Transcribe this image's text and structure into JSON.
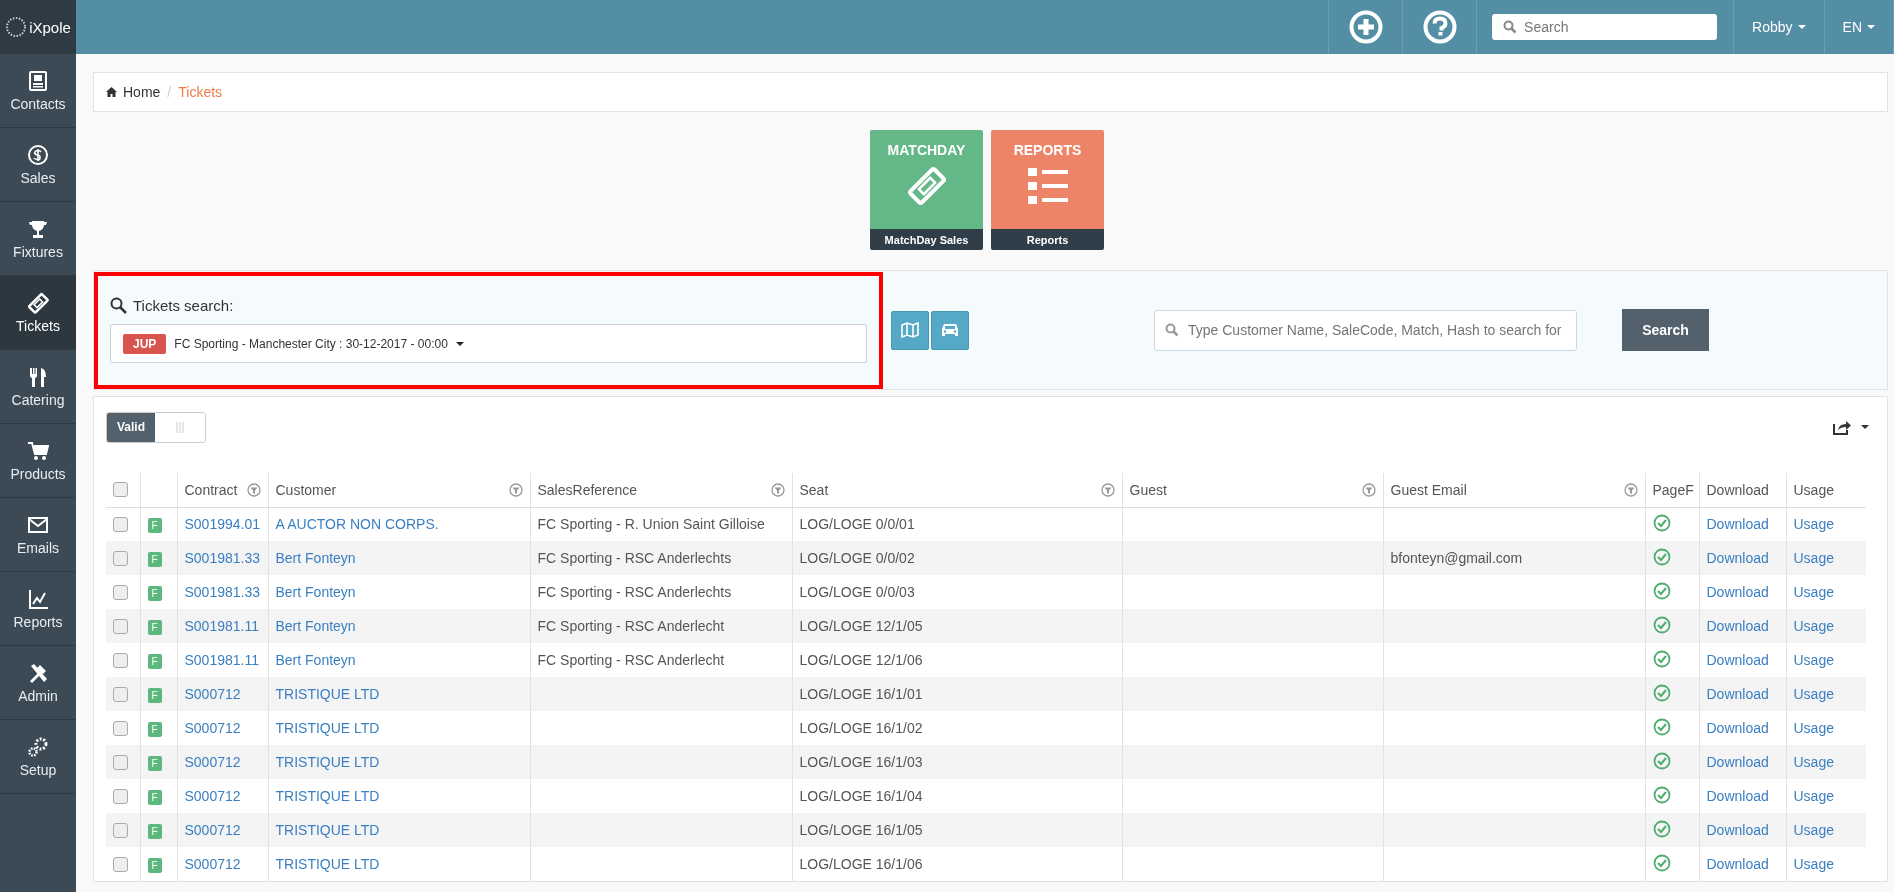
{
  "sidebar": {
    "logo": "iXpole",
    "items": [
      {
        "label": "Contacts",
        "selected": false
      },
      {
        "label": "Sales",
        "selected": false
      },
      {
        "label": "Fixtures",
        "selected": false
      },
      {
        "label": "Tickets",
        "selected": true
      },
      {
        "label": "Catering",
        "selected": false
      },
      {
        "label": "Products",
        "selected": false
      },
      {
        "label": "Emails",
        "selected": false
      },
      {
        "label": "Reports",
        "selected": false
      },
      {
        "label": "Admin",
        "selected": false
      },
      {
        "label": "Setup",
        "selected": false
      }
    ]
  },
  "topbar": {
    "search": {
      "placeholder": "Search"
    },
    "user": "Robby",
    "language": "EN"
  },
  "breadcrumb": [
    {
      "label": "Home",
      "current": false
    },
    {
      "separator": "/",
      "label": "Tickets",
      "current": true
    }
  ],
  "tiles": [
    {
      "title": "MATCHDAY",
      "caption": "MatchDay Sales",
      "color": "#64b888"
    },
    {
      "title": "REPORTS",
      "caption": "Reports",
      "color": "#ee8467"
    }
  ],
  "tickets_search": {
    "label": "Tickets search:",
    "select": {
      "tag": "JUP",
      "value": "FC Sporting - Manchester City : 30-12-2017 - 00:00"
    },
    "highlighted": true
  },
  "quick_search": {
    "placeholder": "Type Customer Name, SaleCode, Match, Hash to search for",
    "button": "Search"
  },
  "valid_toggle": {
    "label": "Valid",
    "on": true
  },
  "table": {
    "select_all": {
      "checked": false
    },
    "columns": [
      {
        "label": "Contract",
        "filter": true
      },
      {
        "label": "Customer",
        "filter": true
      },
      {
        "label": "SalesReference",
        "filter": true
      },
      {
        "label": "Seat",
        "filter": true
      },
      {
        "label": "Guest",
        "filter": true
      },
      {
        "label": "Guest Email",
        "filter": true
      },
      {
        "label": "PageF",
        "filter": false
      },
      {
        "label": "Download",
        "filter": false
      },
      {
        "label": "Usage",
        "filter": false
      }
    ],
    "rows": [
      {
        "checked": false,
        "badge": "F",
        "contract": "S001994.01",
        "customer": "A AUCTOR NON CORPS.",
        "sales_reference": "FC Sporting - R. Union Saint Gilloise",
        "seat": "LOG/LOGE 0/0/01",
        "page_ok": true,
        "download": "Download",
        "usage": "Usage"
      },
      {
        "checked": false,
        "badge": "F",
        "contract": "S001981.33",
        "customer": "Bert Fonteyn",
        "sales_reference": "FC Sporting - RSC Anderlechts",
        "seat": "LOG/LOGE 0/0/02",
        "guest_email": "bfonteyn@gmail.com",
        "page_ok": true,
        "download": "Download",
        "usage": "Usage"
      },
      {
        "checked": false,
        "badge": "F",
        "contract": "S001981.33",
        "customer": "Bert Fonteyn",
        "sales_reference": "FC Sporting - RSC Anderlechts",
        "seat": "LOG/LOGE 0/0/03",
        "page_ok": true,
        "download": "Download",
        "usage": "Usage"
      },
      {
        "checked": false,
        "badge": "F",
        "contract": "S001981.11",
        "customer": "Bert Fonteyn",
        "sales_reference": "FC Sporting - RSC Anderlecht",
        "seat": "LOG/LOGE 12/1/05",
        "page_ok": true,
        "download": "Download",
        "usage": "Usage"
      },
      {
        "checked": false,
        "badge": "F",
        "contract": "S001981.11",
        "customer": "Bert Fonteyn",
        "sales_reference": "FC Sporting - RSC Anderlecht",
        "seat": "LOG/LOGE 12/1/06",
        "page_ok": true,
        "download": "Download",
        "usage": "Usage"
      },
      {
        "checked": false,
        "badge": "F",
        "contract": "S000712",
        "customer": "TRISTIQUE LTD",
        "seat": "LOG/LOGE 16/1/01",
        "page_ok": true,
        "download": "Download",
        "usage": "Usage"
      },
      {
        "checked": false,
        "badge": "F",
        "contract": "S000712",
        "customer": "TRISTIQUE LTD",
        "seat": "LOG/LOGE 16/1/02",
        "page_ok": true,
        "download": "Download",
        "usage": "Usage"
      },
      {
        "checked": false,
        "badge": "F",
        "contract": "S000712",
        "customer": "TRISTIQUE LTD",
        "seat": "LOG/LOGE 16/1/03",
        "page_ok": true,
        "download": "Download",
        "usage": "Usage"
      },
      {
        "checked": false,
        "badge": "F",
        "contract": "S000712",
        "customer": "TRISTIQUE LTD",
        "seat": "LOG/LOGE 16/1/04",
        "page_ok": true,
        "download": "Download",
        "usage": "Usage"
      },
      {
        "checked": false,
        "badge": "F",
        "contract": "S000712",
        "customer": "TRISTIQUE LTD",
        "seat": "LOG/LOGE 16/1/05",
        "page_ok": true,
        "download": "Download",
        "usage": "Usage"
      },
      {
        "checked": false,
        "badge": "F",
        "contract": "S000712",
        "customer": "TRISTIQUE LTD",
        "seat": "LOG/LOGE 16/1/06",
        "page_ok": true,
        "download": "Download",
        "usage": "Usage"
      }
    ]
  }
}
